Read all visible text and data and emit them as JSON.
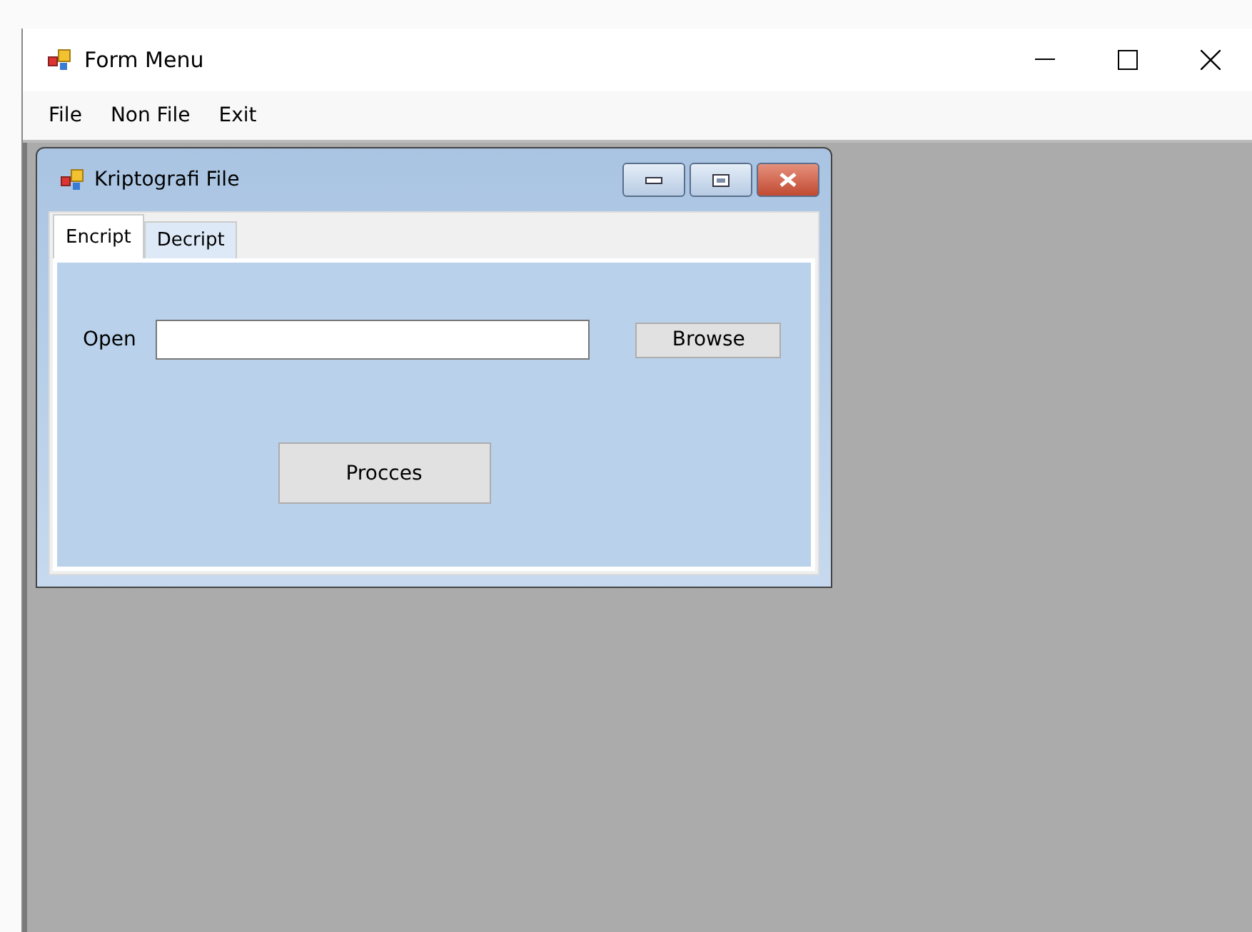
{
  "window": {
    "title": "Form Menu"
  },
  "menu": [
    "File",
    "Non File",
    "Exit"
  ],
  "child_window": {
    "title": "Kriptografi File",
    "tabs": [
      {
        "label": "Encript",
        "selected": true
      },
      {
        "label": "Decript",
        "selected": false
      }
    ],
    "open_label": "Open",
    "browse_button": "Browse",
    "process_button": "Procces"
  }
}
